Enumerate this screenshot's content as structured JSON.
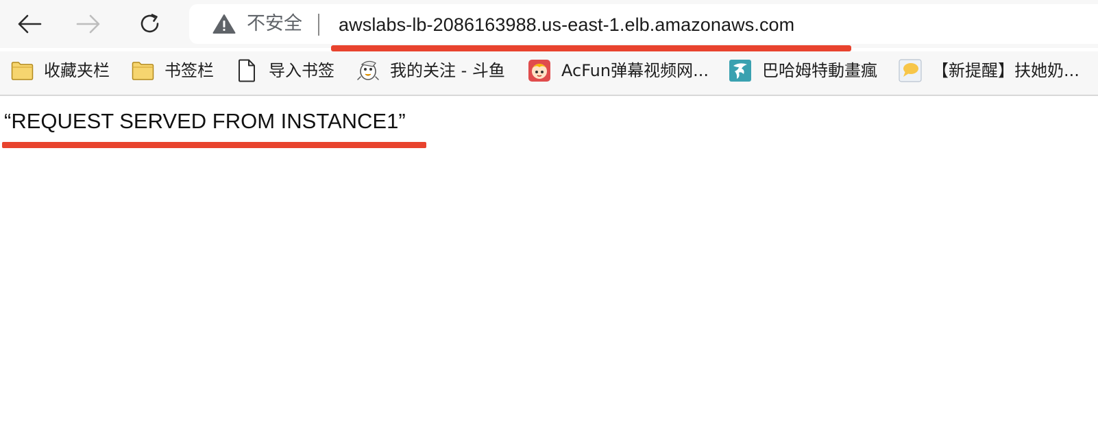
{
  "browser": {
    "nav": {
      "back_icon": "arrow-left-icon",
      "forward_icon": "arrow-right-icon",
      "forward_enabled": false,
      "reload_icon": "reload-icon"
    },
    "omnibox": {
      "security_icon": "warning-triangle-icon",
      "security_label": "不安全",
      "url": "awslabs-lb-2086163988.us-east-1.elb.amazonaws.com"
    }
  },
  "bookmarks": [
    {
      "label": "收藏夹栏",
      "icon": "folder-icon"
    },
    {
      "label": "书签栏",
      "icon": "folder-icon"
    },
    {
      "label": "导入书签",
      "icon": "document-icon"
    },
    {
      "label": "我的关注 - 斗鱼",
      "icon": "douyu-fish-icon"
    },
    {
      "label": "AcFun弹幕视频网...",
      "icon": "acfun-icon"
    },
    {
      "label": "巴哈姆特動畫瘋",
      "icon": "bahamut-icon"
    },
    {
      "label": "【新提醒】扶她奶...",
      "icon": "forum-icon"
    }
  ],
  "page": {
    "response_text": "“REQUEST SERVED FROM INSTANCE1”"
  },
  "colors": {
    "annotation_red": "#e8432e",
    "folder_yellow": "#f6d56f",
    "toolbar_bg": "#f7f7f7"
  }
}
